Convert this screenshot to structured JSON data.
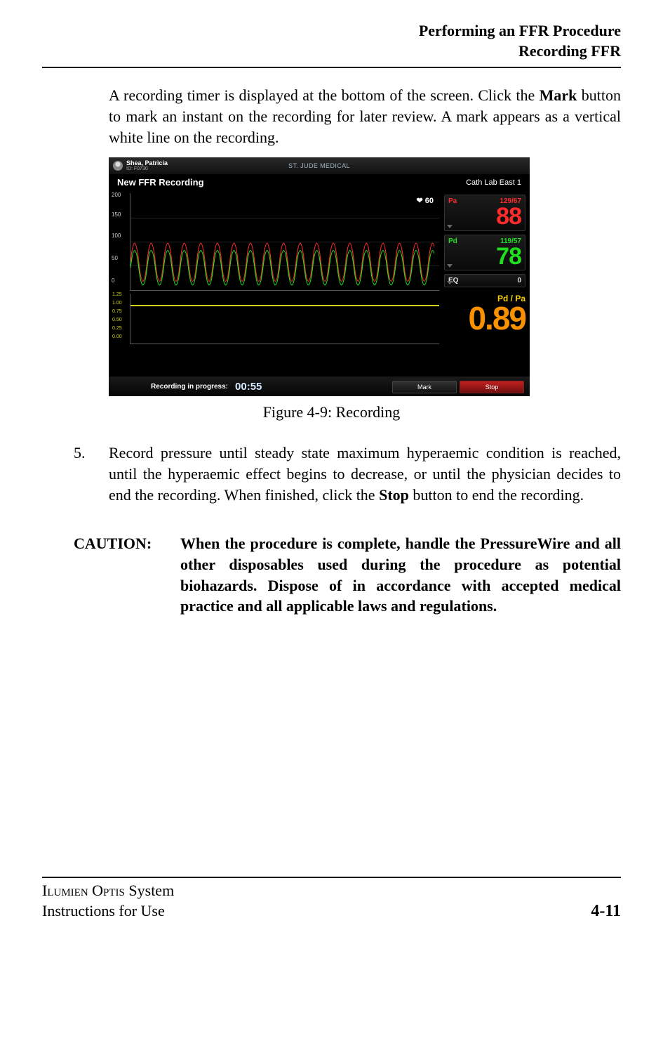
{
  "header": {
    "line1": "Performing an FFR Procedure",
    "line2": "Recording FFR"
  },
  "paragraph1_pre": "A recording timer is displayed at the bottom of the screen. Click the ",
  "paragraph1_bold": "Mark",
  "paragraph1_post": " button to mark an instant on the recording for later review. A mark appears as a vertical white line on the recording.",
  "screenshot": {
    "patient_name": "Shea, Patricia",
    "patient_id": "ID: F0730",
    "brand": "ST. JUDE MEDICAL",
    "title": "New FFR Recording",
    "room": "Cath Lab East 1",
    "hr_value": "60",
    "pa": {
      "label": "Pa",
      "bp": "129/67",
      "mean": "88"
    },
    "pd": {
      "label": "Pd",
      "bp": "119/57",
      "mean": "78"
    },
    "eq": {
      "label": "EQ",
      "value": "0"
    },
    "ratio_label": "Pd / Pa",
    "ratio_value": "0.89",
    "upper_axis": [
      "200",
      "150",
      "100",
      "50",
      "0"
    ],
    "lower_axis": [
      "1.25",
      "1.00",
      "0.75",
      "0.50",
      "0.25",
      "0.00"
    ],
    "status_label": "Recording in progress:",
    "timer": "00:55",
    "mark_btn": "Mark",
    "stop_btn": "Stop"
  },
  "figure_caption": "Figure 4-9:  Recording",
  "step5": {
    "num": "5.",
    "text_pre": "Record pressure until steady state maximum hyperaemic condition is reached, until the hyperaemic effect begins to decrease, or until the physician decides to end the recording. When finished, click the ",
    "text_bold": "Stop",
    "text_post": " button to end the recording."
  },
  "caution": {
    "label": "CAUTION:",
    "text": "When the procedure is complete, handle the PressureWire and all other disposables used during the procedure as potential biohazards. Dispose of in accordance with accepted medical practice and all applicable laws and regulations."
  },
  "footer": {
    "product1": "Ilumien Optis",
    "product2": " System",
    "line2": "Instructions for Use",
    "page": "4-11"
  },
  "chart_data": {
    "type": "line",
    "upper": {
      "ylim": [
        0,
        200
      ],
      "gridlines": [
        0,
        50,
        100,
        150,
        200
      ],
      "series": [
        {
          "name": "Pa",
          "color": "#ff2a2a",
          "approx_range": [
            67,
            129
          ],
          "peaks": 18
        },
        {
          "name": "Pd",
          "color": "#1fe01f",
          "approx_range": [
            57,
            119
          ],
          "peaks": 18
        }
      ],
      "hr": 60
    },
    "lower": {
      "name": "Pd/Pa",
      "ylim": [
        0.0,
        1.25
      ],
      "gridlines": [
        0.0,
        0.25,
        0.5,
        0.75,
        1.0,
        1.25
      ],
      "value": 0.89,
      "color": "#d0d020"
    }
  }
}
